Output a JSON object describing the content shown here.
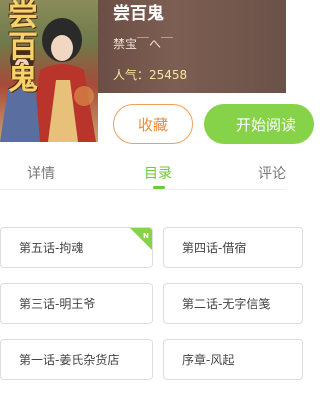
{
  "comic": {
    "cover_text": "尝百鬼",
    "title": "尝百鬼",
    "author": "禁宝￣へ￣",
    "popularity": "人气：25458"
  },
  "actions": {
    "collect_label": "收藏",
    "read_label": "开始阅读"
  },
  "tabs": [
    {
      "label": "详情"
    },
    {
      "label": "目录"
    },
    {
      "label": "评论"
    }
  ],
  "chapters": [
    {
      "label": "第五话-拘魂",
      "badge": "N"
    },
    {
      "label": "第四话-借宿"
    },
    {
      "label": "第三话-明王爷"
    },
    {
      "label": "第二话-无字信笺"
    },
    {
      "label": "第一话-姜氏杂货店"
    },
    {
      "label": "序章-风起"
    }
  ],
  "colors": {
    "accent_green": "#6dc83c",
    "collect_orange": "#ee8b3a"
  }
}
